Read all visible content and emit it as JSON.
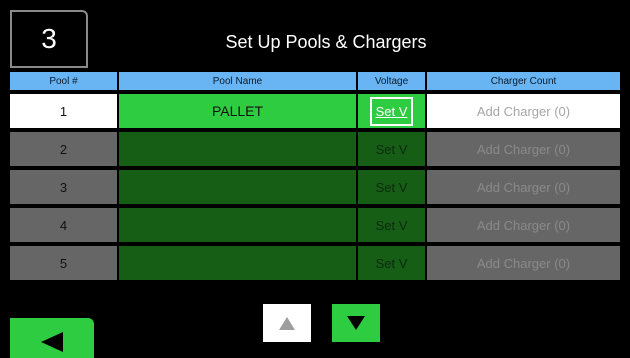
{
  "step_number": "3",
  "title": "Set Up Pools & Chargers",
  "table": {
    "headers": [
      "Pool #",
      "Pool Name",
      "Voltage",
      "Charger Count"
    ],
    "rows": [
      {
        "pool": "1",
        "name": "PALLET",
        "voltage": "Set V",
        "charger": "Add Charger (0)",
        "active": true
      },
      {
        "pool": "2",
        "name": "",
        "voltage": "Set V",
        "charger": "Add Charger (0)",
        "active": false
      },
      {
        "pool": "3",
        "name": "",
        "voltage": "Set V",
        "charger": "Add Charger (0)",
        "active": false
      },
      {
        "pool": "4",
        "name": "",
        "voltage": "Set V",
        "charger": "Add Charger (0)",
        "active": false
      },
      {
        "pool": "5",
        "name": "",
        "voltage": "Set V",
        "charger": "Add Charger (0)",
        "active": false
      }
    ]
  },
  "nav": {
    "back_icon": "arrow-left-icon",
    "up_icon": "arrow-up-icon",
    "down_icon": "arrow-down-icon"
  },
  "colors": {
    "accent_green": "#2ecc40",
    "dark_green": "#165e16",
    "header_blue": "#69b4f3",
    "row_gray": "#666666"
  }
}
